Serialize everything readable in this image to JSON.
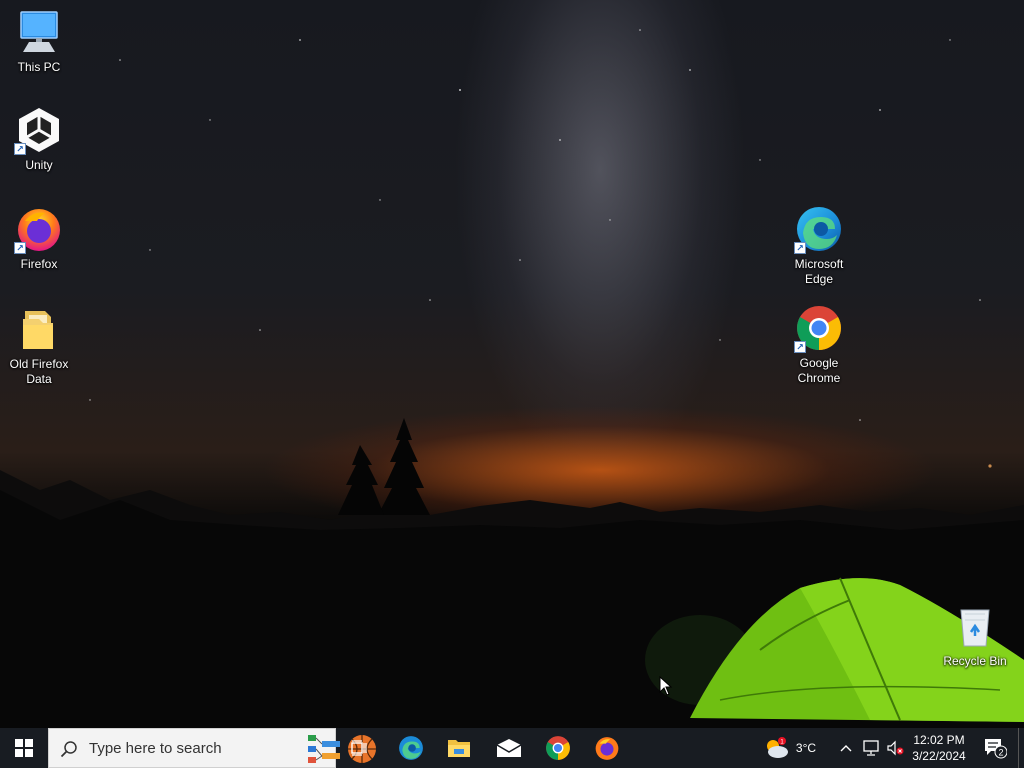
{
  "desktop": {
    "icons_left": [
      {
        "label": "This PC",
        "icon": "this-pc-icon"
      },
      {
        "label": "Unity",
        "icon": "unity-icon"
      },
      {
        "label": "Firefox",
        "icon": "firefox-icon"
      },
      {
        "label": "Old Firefox Data",
        "icon": "folder-icon"
      }
    ],
    "icons_right": [
      {
        "label": "Microsoft Edge",
        "icon": "edge-icon"
      },
      {
        "label": "Google Chrome",
        "icon": "chrome-icon"
      },
      {
        "label": "Recycle Bin",
        "icon": "recycle-bin-icon"
      }
    ]
  },
  "taskbar": {
    "search_placeholder": "Type here to search",
    "pinned": [
      "edge-icon",
      "file-explorer-icon",
      "mail-icon",
      "chrome-icon",
      "firefox-icon"
    ],
    "weather": {
      "temp": "3°C",
      "badge": "1"
    },
    "clock": {
      "time": "12:02 PM",
      "date": "3/22/2024"
    },
    "notification_count": "2"
  },
  "colors": {
    "taskbar_bg": "#181c22",
    "search_bg": "#f3f3f3",
    "accent_blue": "#0078d7"
  }
}
